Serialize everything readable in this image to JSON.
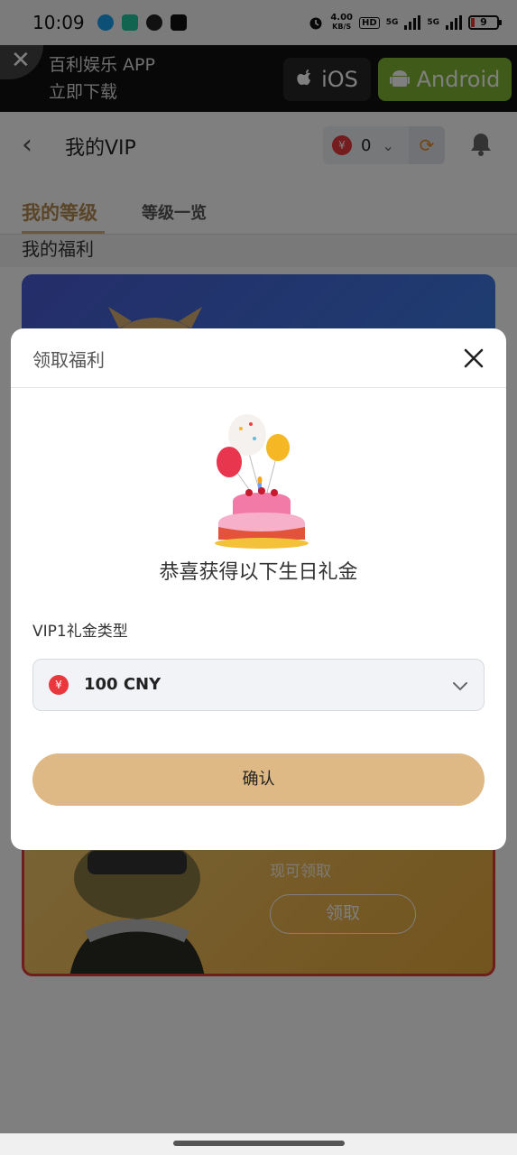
{
  "status_bar": {
    "time": "10:09",
    "net_speed_value": "4.00",
    "net_speed_unit": "KB/S",
    "hd_label": "HD",
    "signal_1": "5G",
    "signal_2": "5G",
    "battery": "9"
  },
  "banner": {
    "close_glyph": "✕",
    "line1": "百利娱乐 APP",
    "line2": "立即下载",
    "ios_label": "iOS",
    "android_label": "Android",
    "ios_color": "#262626",
    "android_color": "#7eb433"
  },
  "header": {
    "back_glyph": "‹",
    "title": "我的VIP",
    "coin_symbol": "¥",
    "balance": "0",
    "caret_glyph": "⌄",
    "refresh_glyph": "⟳"
  },
  "tabs": {
    "active": "我的等级",
    "other": "等级一览",
    "accent_color": "#b58a50"
  },
  "section": {
    "title": "我的福利"
  },
  "reward_card": {
    "hint": "现可领取",
    "claim": "领取"
  },
  "modal": {
    "title": "领取福利",
    "congrats": "恭喜获得以下生日礼金",
    "type_label": "VIP1礼金类型",
    "coin_symbol": "¥",
    "selected_amount": "100 CNY",
    "confirm": "确认",
    "confirm_color": "#dfb985"
  }
}
